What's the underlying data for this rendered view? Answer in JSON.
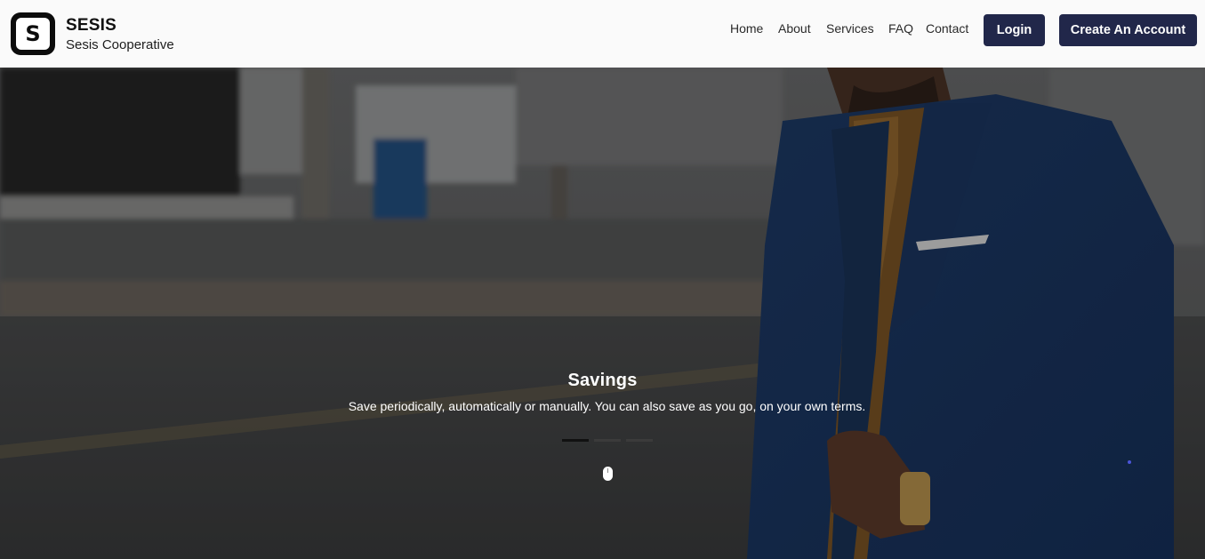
{
  "brand": {
    "logo_letter": "S",
    "title": "SESIS",
    "subtitle": "Sesis Cooperative"
  },
  "nav": {
    "links": [
      "Home",
      "About",
      "Services",
      "FAQ",
      "Contact"
    ],
    "login_label": "Login",
    "signup_label": "Create An Account"
  },
  "hero": {
    "title": "Savings",
    "text": "Save periodically, automatically or manually. You can also save as you go, on your own terms.",
    "slides_total": 3,
    "active_slide": 1
  },
  "icons": {
    "logo": "s-logo-icon",
    "scroll": "mouse-scroll-icon"
  },
  "colors": {
    "nav_bg": "#fafafa",
    "button_bg": "#21274a",
    "button_text": "#ffffff",
    "indicator_active": "#111111",
    "indicator_inactive": "#3b3b3b"
  }
}
